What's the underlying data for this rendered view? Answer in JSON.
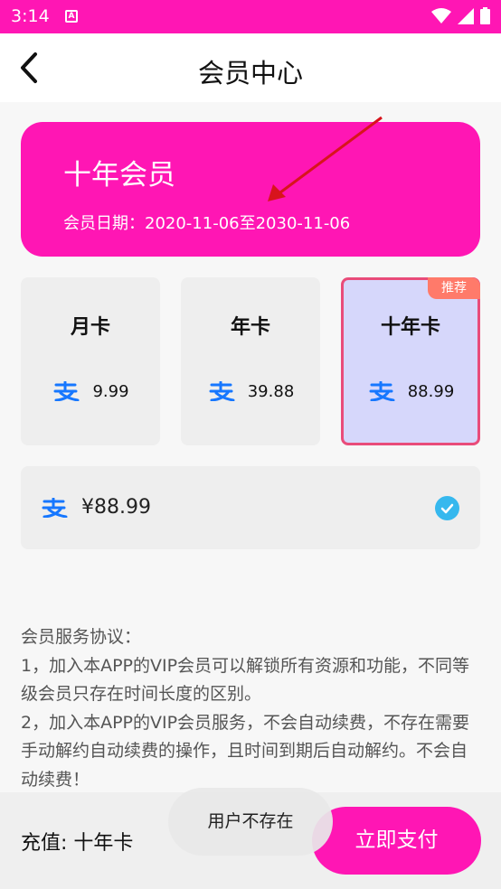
{
  "status_bar": {
    "time": "3:14",
    "notification_letter": "A"
  },
  "header": {
    "title": "会员中心"
  },
  "vip_card": {
    "name": "十年会员",
    "dates": "会员日期：2020-11-06至2030-11-06"
  },
  "plans": [
    {
      "name": "月卡",
      "price": "9.99",
      "selected": false
    },
    {
      "name": "年卡",
      "price": "39.88",
      "selected": false
    },
    {
      "name": "十年卡",
      "price": "88.99",
      "selected": true,
      "badge": "推荐"
    }
  ],
  "payment": {
    "amount": "¥88.99",
    "method_icon": "alipay-icon",
    "checked": true
  },
  "agreement": {
    "title": "会员服务协议：",
    "line1": " 1，加入本APP的VIP会员可以解锁所有资源和功能，不同等级会员只存在时间长度的区别。",
    "line2": " 2，加入本APP的VIP会员服务，不会自动续费，不存在需要手动解约自动续费的操作，且时间到期后自动解约。不会自动续费！"
  },
  "bottom": {
    "recharge": "充值: 十年卡",
    "pay_button": "立即支付"
  },
  "toast": {
    "text": "用户不存在"
  },
  "colors": {
    "brand": "#ff16b4",
    "alipay": "#1677ff",
    "check": "#36b8ee",
    "selected_border": "#e94c7a",
    "badge": "#ff7a6a"
  }
}
